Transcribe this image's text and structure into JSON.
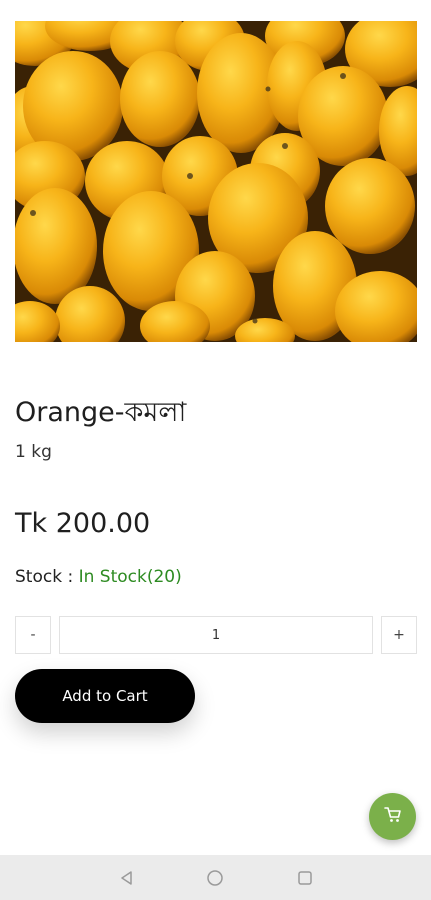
{
  "product": {
    "image_icon": "oranges-photo",
    "title": "Orange-কমলা",
    "unit": "1 kg",
    "price": "Tk 200.00",
    "stock_label": "Stock : ",
    "stock_value": "In Stock(20)",
    "stock_color": "#2e8b22"
  },
  "quantity": {
    "minus_label": "-",
    "value": "1",
    "plus_label": "+"
  },
  "actions": {
    "add_to_cart_label": "Add to Cart",
    "cart_fab_icon": "cart-icon",
    "cart_fab_color": "#7bb04a"
  },
  "system_nav": {
    "back_icon": "back-triangle-icon",
    "home_icon": "home-circle-icon",
    "recents_icon": "recents-square-icon"
  }
}
